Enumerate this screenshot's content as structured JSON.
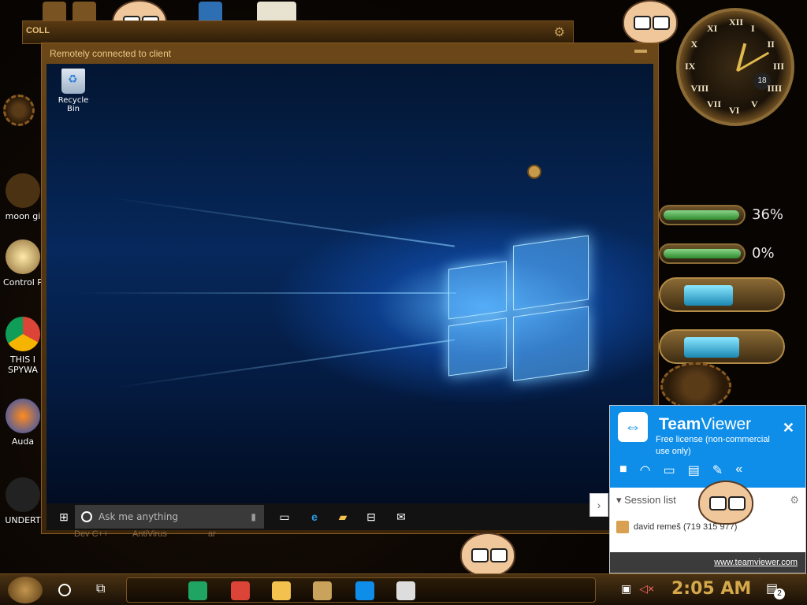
{
  "background_window": {
    "title": "COLL"
  },
  "remote_window": {
    "title": "Remotely connected to client",
    "desktop": {
      "recycle_bin_label": "Recycle Bin",
      "taskbar": {
        "search_placeholder": "Ask me anything"
      }
    }
  },
  "left_desktop_icons": [
    {
      "label": "moon gi",
      "icon": "moon-icon"
    },
    {
      "label": "Control P",
      "icon": "lightbulb-icon"
    },
    {
      "label": "THIS I\nSPYWA",
      "icon": "chrome-icon"
    },
    {
      "label": "Auda",
      "icon": "audacity-icon"
    },
    {
      "label": "UNDERT",
      "icon": "undertale-icon"
    }
  ],
  "gadgets": {
    "clock": {
      "numerals": [
        "XII",
        "I",
        "II",
        "III",
        "IIII",
        "V",
        "VI",
        "VII",
        "VIII",
        "IX",
        "X",
        "XI"
      ],
      "date": "18"
    },
    "cpu_meter": {
      "value_label": "36%",
      "level": 0.36
    },
    "ram_meter": {
      "value_label": "0%",
      "level": 0.0
    }
  },
  "teamviewer": {
    "brand_bold": "Team",
    "brand_rest": "Viewer",
    "license": "Free license (non-commercial use only)",
    "tools": [
      "video-icon",
      "headset-icon",
      "chat-icon",
      "file-icon",
      "brush-icon",
      "collapse-icon"
    ],
    "session_list_label": "Session list",
    "session": {
      "name": "david remeš (719 315 977)"
    },
    "footer_link": "www.teamviewer.com"
  },
  "behind_text": {
    "left": "Dev C++",
    "mid": "AntiVirus",
    "right": "ar"
  },
  "taskbar": {
    "time": "2:05 AM",
    "notification_count": "2",
    "apps": [
      {
        "name": "sheets-icon",
        "color": "#1fa463"
      },
      {
        "name": "chrome-icon",
        "color": "#db4437"
      },
      {
        "name": "folder-icon",
        "color": "#f2c14e"
      },
      {
        "name": "box-game-icon",
        "color": "#c9a25c"
      },
      {
        "name": "teamviewer-icon",
        "color": "#0e8ee9"
      },
      {
        "name": "skull-icon",
        "color": "#dddddd"
      }
    ]
  },
  "colors": {
    "teamviewer_blue": "#0e8ee9",
    "clock_gold": "#d5a84b",
    "steampunk_brown": "#6b4718"
  }
}
